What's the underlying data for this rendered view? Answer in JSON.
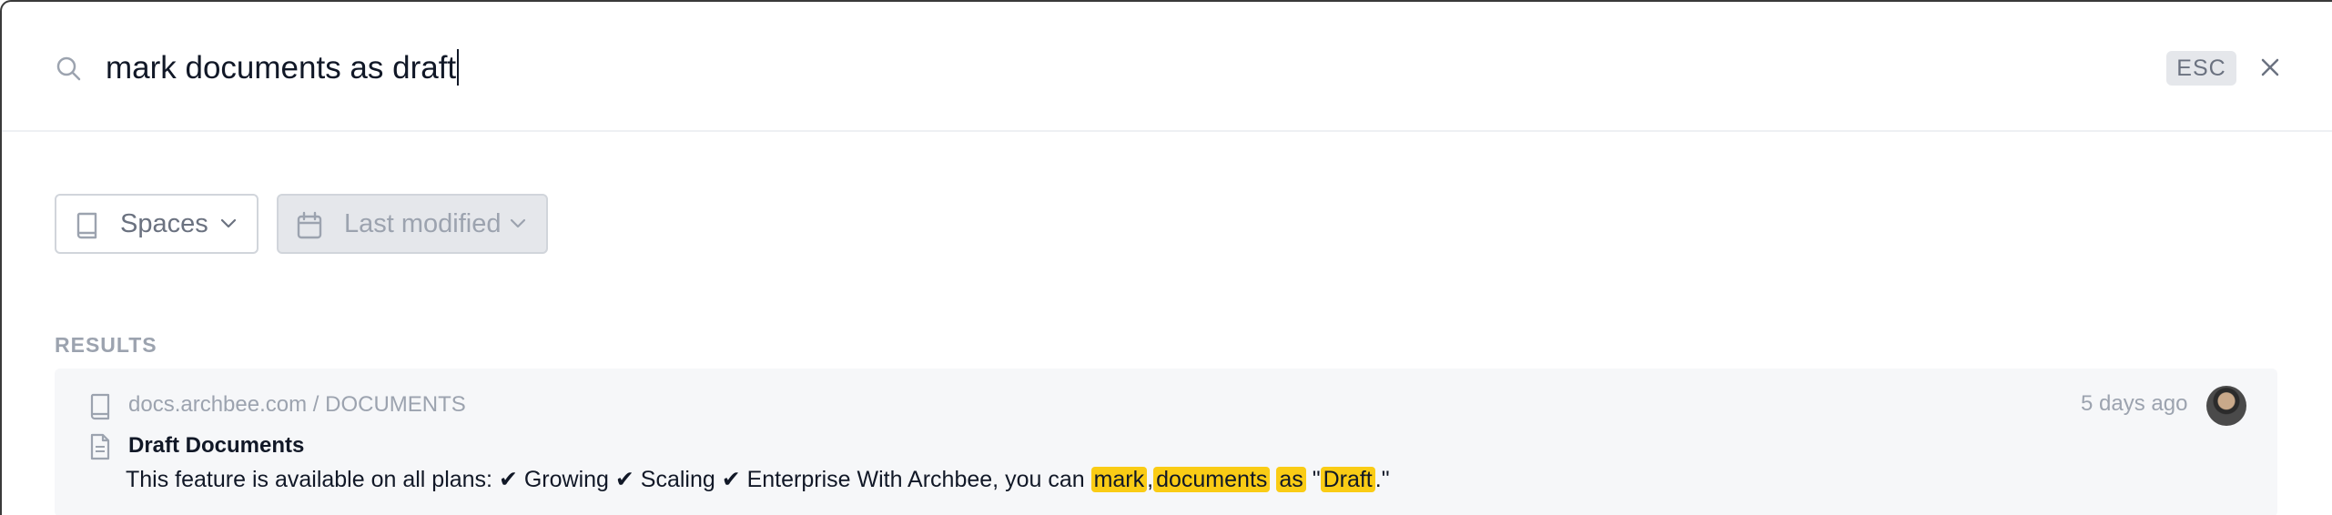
{
  "search": {
    "query": "mark documents as draft",
    "esc_label": "ESC"
  },
  "filters": {
    "spaces_label": "Spaces",
    "last_modified_label": "Last modified"
  },
  "results": {
    "heading": "RESULTS",
    "items": [
      {
        "breadcrumb": "docs.archbee.com / DOCUMENTS",
        "timestamp": "5 days ago",
        "title": "Draft Documents",
        "snippet": {
          "prefix": "This feature is available on all plans: ✔ Growing ✔ Scaling ✔ Enterprise With Archbee, you can ",
          "hl1": "mark",
          "sep1": ",",
          "hl2": "documents",
          "sep2": " ",
          "hl3": "as",
          "sep3": " \"",
          "hl4": "Draft",
          "suffix": ".\""
        }
      }
    ]
  },
  "colors": {
    "highlight": "#facc15",
    "muted_text": "#9ca3af",
    "card_background": "#f6f7f9"
  },
  "icons": [
    "search-icon",
    "close-icon",
    "book-icon",
    "calendar-icon",
    "chevron-down-icon",
    "document-icon",
    "avatar"
  ]
}
